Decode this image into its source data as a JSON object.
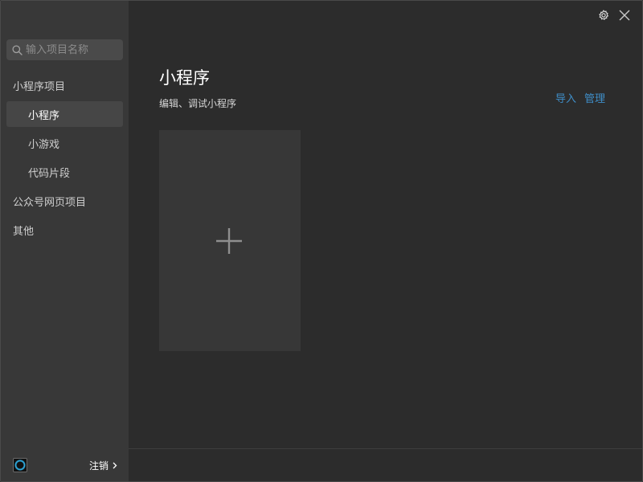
{
  "search": {
    "placeholder": "输入项目名称"
  },
  "sidebar": {
    "items": [
      {
        "label": "小程序项目"
      },
      {
        "label": "小程序"
      },
      {
        "label": "小游戏"
      },
      {
        "label": "代码片段"
      },
      {
        "label": "公众号网页项目"
      },
      {
        "label": "其他"
      }
    ],
    "active_item": "小程序",
    "logout_label": "注销"
  },
  "main": {
    "title": "小程序",
    "subtitle": "编辑、调试小程序",
    "import_label": "导入",
    "manage_label": "管理"
  },
  "icons": {
    "search": "search-icon",
    "gear": "gear-icon",
    "close": "close-icon",
    "plus": "plus-icon",
    "chevron": "chevron-right-icon"
  },
  "colors": {
    "sidebar_bg": "#383838",
    "main_bg": "#2c2c2c",
    "active_item_bg": "#464646",
    "link": "#3f8ec8",
    "card_bg": "#373737"
  }
}
